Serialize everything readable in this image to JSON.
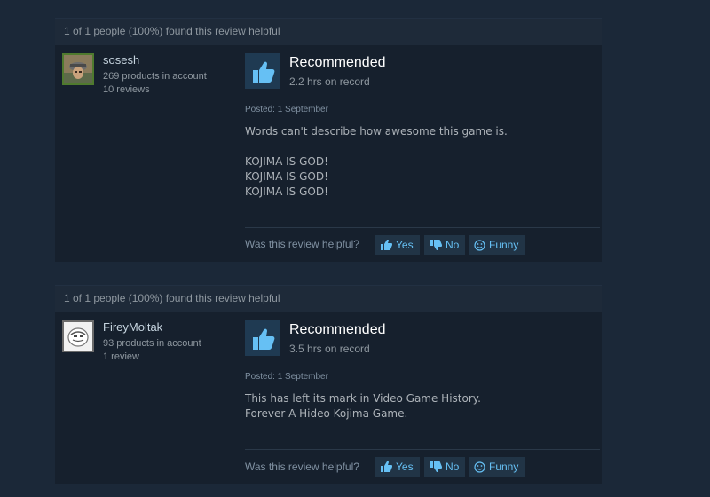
{
  "reviews": [
    {
      "helpful_summary": "1 of 1 people (100%) found this review helpful",
      "author": {
        "name": "sosesh",
        "products": "269 products in account",
        "reviews": "10 reviews"
      },
      "recommendation": "Recommended",
      "hours": "2.2 hrs on record",
      "posted": "Posted: 1 September",
      "paragraphs": [
        "Words can't describe how awesome this game is.",
        "KOJIMA IS GOD!",
        "KOJIMA IS GOD!",
        "KOJIMA IS GOD!"
      ],
      "helpful_prompt": "Was this review helpful?",
      "buttons": {
        "yes": "Yes",
        "no": "No",
        "funny": "Funny"
      }
    },
    {
      "helpful_summary": "1 of 1 people (100%) found this review helpful",
      "author": {
        "name": "FireyMoltak",
        "products": "93 products in account",
        "reviews": "1 review"
      },
      "recommendation": "Recommended",
      "hours": "3.5 hrs on record",
      "posted": "Posted: 1 September",
      "paragraphs": [
        "This has left its mark in Video Game History.",
        "Forever A Hideo Kojima Game."
      ],
      "helpful_prompt": "Was this review helpful?",
      "buttons": {
        "yes": "Yes",
        "no": "No",
        "funny": "Funny"
      }
    }
  ],
  "icons": {
    "thumb": "thumbs-up-icon",
    "yes": "thumbs-up-icon",
    "no": "thumbs-down-icon",
    "funny": "smiley-icon"
  },
  "colors": {
    "background": "#1b2838",
    "panel": "#16202d",
    "accent": "#66c0f4",
    "thumb_box": "#1f3a52"
  }
}
